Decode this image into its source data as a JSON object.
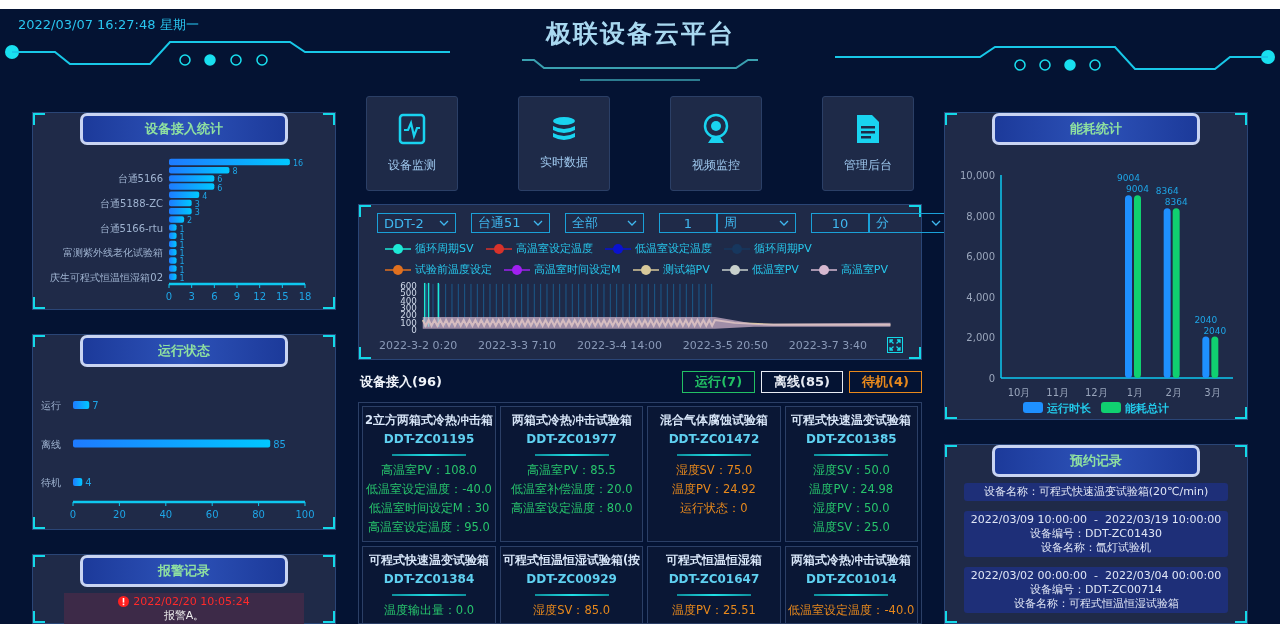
{
  "header": {
    "datetime": "2022/03/07 16:27:48 星期一",
    "title": "极联设备云平台"
  },
  "device_stats": {
    "title": "设备接入统计",
    "chart_data": {
      "type": "bar",
      "orientation": "horizontal",
      "categories": [
        null,
        null,
        "台通5166",
        null,
        null,
        "台通5188-ZC",
        null,
        null,
        "台通5166-rtu",
        null,
        null,
        "富测紫外线老化试验箱",
        null,
        null,
        "庆生可程式恒温恒湿箱02"
      ],
      "values": [
        16,
        8,
        6,
        6,
        4,
        3,
        3,
        2,
        1,
        1,
        1,
        1,
        1,
        1,
        1
      ],
      "xlim": [
        0,
        18
      ],
      "xticks": [
        0,
        3,
        6,
        9,
        12,
        15,
        18
      ],
      "data_labels": true
    }
  },
  "run_status": {
    "title": "运行状态",
    "chart_data": {
      "type": "bar",
      "orientation": "horizontal",
      "categories": [
        "运行",
        "离线",
        "待机"
      ],
      "values": [
        7,
        85,
        4
      ],
      "xlim": [
        0,
        100
      ],
      "xticks": [
        0,
        20,
        40,
        60,
        80,
        100
      ],
      "data_labels": true
    }
  },
  "alarms": {
    "title": "报警记录",
    "items": [
      {
        "time": "2022/02/20 10:05:24",
        "message": "报警A。"
      }
    ]
  },
  "nav": [
    {
      "label": "设备监测",
      "kind": "monitor"
    },
    {
      "label": "实时数据",
      "kind": "data"
    },
    {
      "label": "视频监控",
      "kind": "video"
    },
    {
      "label": "管理后台",
      "kind": "admin"
    }
  ],
  "trend": {
    "filter_groups": [
      {
        "controls": [
          {
            "kind": "select",
            "value": "DDT-2"
          }
        ]
      },
      {
        "controls": [
          {
            "kind": "select",
            "value": "台通51"
          }
        ]
      },
      {
        "controls": [
          {
            "kind": "select",
            "value": "全部"
          }
        ]
      },
      {
        "controls": [
          {
            "kind": "input",
            "value": "1"
          },
          {
            "kind": "select",
            "value": "周"
          }
        ]
      },
      {
        "controls": [
          {
            "kind": "input",
            "value": "10"
          },
          {
            "kind": "select",
            "value": "分"
          }
        ]
      }
    ],
    "legend": [
      {
        "label": "循环周期SV",
        "color": "#1de9d6"
      },
      {
        "label": "高温室设定温度",
        "color": "#d8322a"
      },
      {
        "label": "低温室设定温度",
        "color": "#0a12d0"
      },
      {
        "label": "循环周期PV",
        "color": "#17375e"
      },
      {
        "label": "试验前温度设定",
        "color": "#e0701f"
      },
      {
        "label": "高温室时间设定M",
        "color": "#a020f0"
      },
      {
        "label": "测试箱PV",
        "color": "#d8c99a"
      },
      {
        "label": "低温室PV",
        "color": "#c8d0cc"
      },
      {
        "label": "高温室PV",
        "color": "#d6b8d0"
      }
    ],
    "y_axis_labels": [
      "600",
      "500",
      "400",
      "300",
      "200",
      "100",
      "0"
    ],
    "x_axis_labels": [
      "2022-3-2 0:20",
      "2022-3-3 7:10",
      "2022-3-4 14:00",
      "2022-3-5 20:50",
      "2022-3-7 3:40"
    ]
  },
  "devices": {
    "title": "设备接入(96)",
    "filters": [
      {
        "label": "运行(7)",
        "color": "#22c064"
      },
      {
        "label": "离线(85)",
        "color": "#e8ecf4"
      },
      {
        "label": "待机(4)",
        "color": "#e8891c"
      }
    ],
    "cards": [
      {
        "name": "2立方两箱式冷热冲击箱",
        "code": "DDT-ZC01195",
        "color": "#27c46c",
        "readings": [
          "高温室PV：108.0",
          "低温室设定温度：-40.0",
          "低温室时间设定M：30",
          "高温室设定温度：95.0"
        ]
      },
      {
        "name": "两箱式冷热冲击试验箱",
        "code": "DDT-ZC01977",
        "color": "#27c46c",
        "readings": [
          "高温室PV：85.5",
          "低温室补偿温度：20.0",
          "高温室设定温度：80.0"
        ]
      },
      {
        "name": "混合气体腐蚀试验箱",
        "code": "DDT-ZC01472",
        "color": "#e8891c",
        "readings": [
          "湿度SV：75.0",
          "温度PV：24.92",
          "运行状态：0"
        ]
      },
      {
        "name": "可程式快速温变试验箱",
        "code": "DDT-ZC01385",
        "color": "#27c46c",
        "readings": [
          "湿度SV：50.0",
          "温度PV：24.98",
          "湿度PV：50.0",
          "温度SV：25.0"
        ]
      },
      {
        "name": "可程式快速温变试验箱",
        "code": "DDT-ZC01384",
        "color": "#27c46c",
        "readings": [
          "温度输出量：0.0"
        ]
      },
      {
        "name": "可程式恒温恒湿试验箱(按",
        "code": "DDT-ZC00929",
        "color": "#e8891c",
        "readings": [
          "湿度SV：85.0"
        ]
      },
      {
        "name": "可程式恒温恒湿箱",
        "code": "DDT-ZC01647",
        "color": "#e8891c",
        "readings": [
          "温度PV：25.51"
        ]
      },
      {
        "name": "两箱式冷热冲击试验箱",
        "code": "DDT-ZC01014",
        "color": "#e8891c",
        "readings": [
          "低温室设定温度：-40.0"
        ]
      }
    ]
  },
  "energy": {
    "title": "能耗统计",
    "chart_data": {
      "type": "bar",
      "categories": [
        "10月",
        "11月",
        "12月",
        "1月",
        "2月",
        "3月"
      ],
      "series": [
        {
          "name": "运行时长",
          "color": "#1e90ff",
          "values": [
            0,
            0,
            0,
            9004,
            8364,
            2040
          ],
          "value_labels": [
            null,
            null,
            null,
            "9004",
            "8364",
            "2040"
          ]
        },
        {
          "name": "能耗总计",
          "color": "#10d070",
          "values": [
            0,
            0,
            0,
            9004,
            8364,
            2040
          ],
          "value_labels": [
            null,
            null,
            null,
            "9004",
            "8364",
            "2040"
          ]
        }
      ],
      "legend": "bottom",
      "ylim": [
        0,
        10000
      ],
      "yticks": [
        {
          "value": 0,
          "label": "0"
        },
        {
          "value": 2000,
          "label": "2,000"
        },
        {
          "value": 4000,
          "label": "4,000"
        },
        {
          "value": 6000,
          "label": "6,000"
        },
        {
          "value": 8000,
          "label": "8,000"
        },
        {
          "value": 10000,
          "label": "10,000"
        }
      ]
    }
  },
  "bookings": {
    "title": "预约记录",
    "records": [
      {
        "lines": [
          "设备名称：可程式快速温变试验箱(20℃/min)"
        ]
      },
      {
        "lines": [
          "2022/03/09 10:00:00  -  2022/03/19 10:00:00",
          "设备编号：DDT-ZC01430",
          "设备名称：氙灯试验机"
        ]
      },
      {
        "lines": [
          "2022/03/02 00:00:00  -  2022/03/04 00:00:00",
          "设备编号：DDT-ZC00714",
          "设备名称：可程式恒温恒湿试验箱"
        ]
      }
    ]
  }
}
